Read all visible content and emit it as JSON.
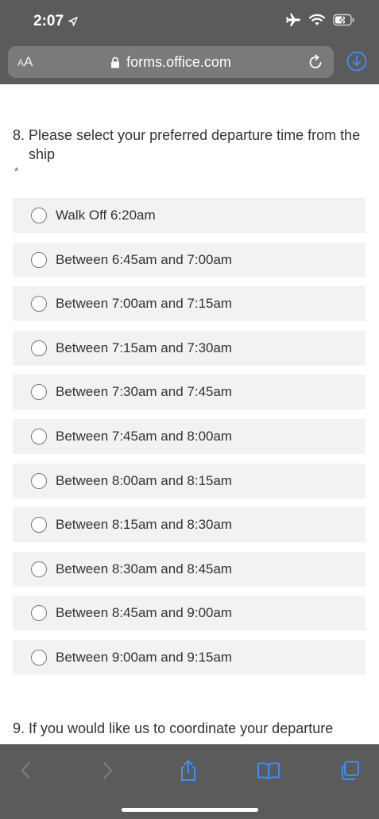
{
  "status": {
    "time": "2:07",
    "icons": [
      "location-arrow-icon",
      "airplane-icon",
      "wifi-icon",
      "battery-charging-icon"
    ]
  },
  "browser": {
    "aa_small": "A",
    "aa_large": "A",
    "url": "forms.office.com",
    "icons": [
      "lock-icon",
      "reload-icon",
      "download-icon"
    ]
  },
  "form": {
    "question": {
      "number": "8.",
      "text": "Please select your preferred departure time from the ship",
      "required_marker": "*"
    },
    "options": [
      "Walk Off 6:20am",
      "Between 6:45am and 7:00am",
      "Between 7:00am and 7:15am",
      "Between 7:15am and 7:30am",
      "Between 7:30am and 7:45am",
      "Between 7:45am and 8:00am",
      "Between 8:00am and 8:15am",
      "Between 8:15am and 8:30am",
      "Between 8:30am and 8:45am",
      "Between 8:45am and 9:00am",
      "Between 9:00am and 9:15am"
    ],
    "next_question": "9. If you would like us to coordinate your departure"
  },
  "toolbar": {
    "icons": [
      "back-icon",
      "forward-icon",
      "share-icon",
      "bookmarks-icon",
      "tabs-icon"
    ]
  },
  "colors": {
    "chrome": "#5b5b5b",
    "accent": "#3e8ef7",
    "option_bg": "#f2f2f2"
  }
}
